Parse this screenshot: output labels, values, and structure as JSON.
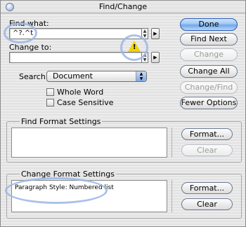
{
  "window": {
    "title": "Find/Change"
  },
  "find": {
    "label": "Find what:",
    "value": "^?.^t"
  },
  "change": {
    "label": "Change to:",
    "value": ""
  },
  "search": {
    "label": "Search:",
    "selected": "Document"
  },
  "options": {
    "whole_word": "Whole Word",
    "case_sensitive": "Case Sensitive",
    "whole_word_checked": false,
    "case_sensitive_checked": false
  },
  "buttons": {
    "done": "Done",
    "find_next": "Find Next",
    "change": "Change",
    "change_all": "Change All",
    "change_find": "Change/Find",
    "fewer_options": "Fewer Options"
  },
  "find_format": {
    "title": "Find Format Settings",
    "text": "",
    "format_button": "Format...",
    "clear_button": "Clear"
  },
  "change_format": {
    "title": "Change Format Settings",
    "text": "Paragraph Style: Numbered list",
    "format_button": "Format...",
    "clear_button": "Clear"
  },
  "icons": {
    "warning": "warning-icon",
    "close": "close-icon",
    "popup_arrow": "triangle-right-icon",
    "spinner": "up-down-arrows-icon"
  },
  "colors": {
    "default_button": "#6fa6ea",
    "highlight_ring": "#9ab7e3",
    "warning": "#f1d400"
  }
}
